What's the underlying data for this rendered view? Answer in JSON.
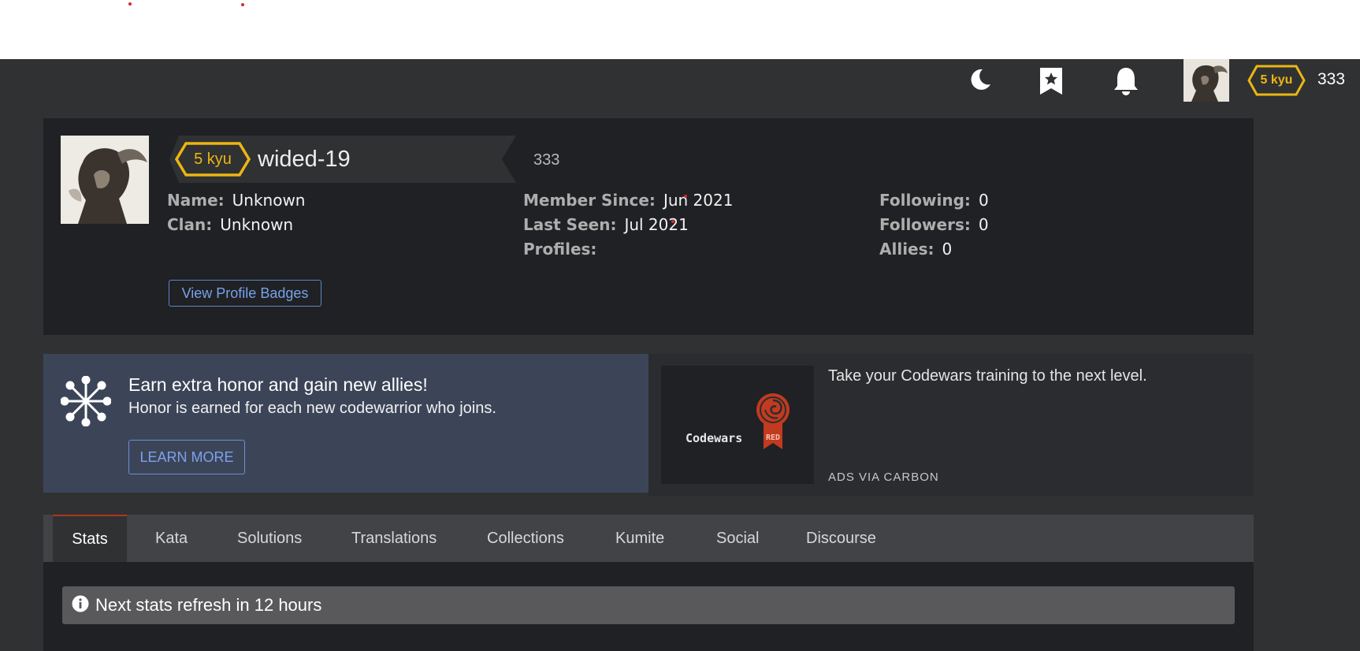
{
  "topbar": {
    "rank": "5 kyu",
    "honor": "333",
    "icons": [
      "moon-icon",
      "bookmark-star-icon",
      "bell-icon"
    ]
  },
  "profile": {
    "rank": "5 kyu",
    "username": "wided-19",
    "honor": "333",
    "name_label": "Name:",
    "name": "Unknown",
    "clan_label": "Clan:",
    "clan": "Unknown",
    "member_since_label": "Member Since:",
    "member_since": "Jun 2021",
    "last_seen_label": "Last Seen:",
    "last_seen": "Jul 2021",
    "profiles_label": "Profiles:",
    "following_label": "Following:",
    "following": "0",
    "followers_label": "Followers:",
    "followers": "0",
    "allies_label": "Allies:",
    "allies": "0",
    "badges_button": "View Profile Badges"
  },
  "promo": {
    "title": "Earn extra honor and gain new allies!",
    "subtitle": "Honor is earned for each new codewarrior who joins.",
    "button": "LEARN MORE"
  },
  "ad": {
    "logo_text": "Codewars",
    "ribbon_text": "RED",
    "text": "Take your Codewars training to the next level.",
    "via": "ADS VIA CARBON"
  },
  "tabs": [
    "Stats",
    "Kata",
    "Solutions",
    "Translations",
    "Collections",
    "Kumite",
    "Social",
    "Discourse"
  ],
  "alert": {
    "text": "Next stats refresh in 12 hours"
  },
  "colors": {
    "rank_yellow": "#ecb613",
    "accent_blue": "#76a2ea",
    "codewars_red": "#b1361e"
  }
}
